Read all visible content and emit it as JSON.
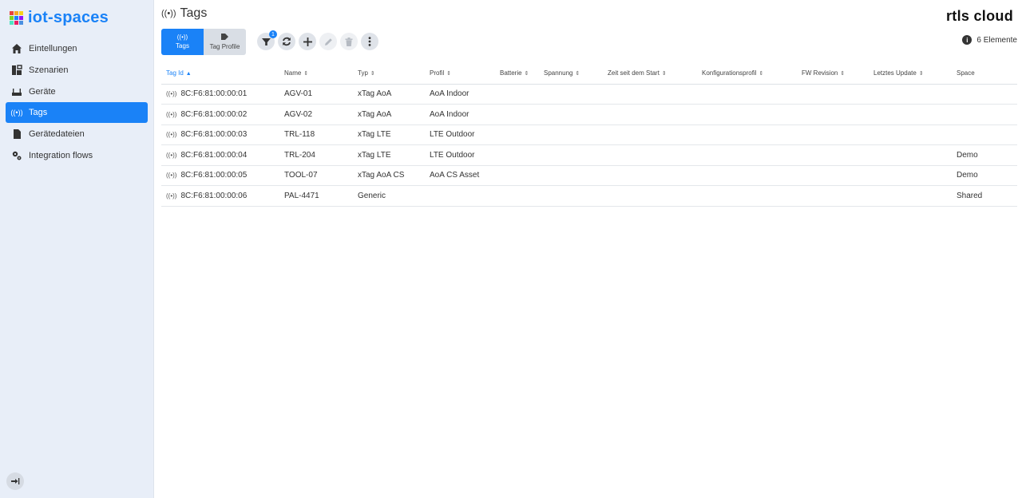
{
  "sidebar": {
    "brand": "iot-spaces",
    "brand_colors": [
      "#e8413c",
      "#f5a623",
      "#f8d11c",
      "#7ed321",
      "#1a82f7",
      "#9013fe",
      "#50e3c2",
      "#e91e63",
      "#4a90e2"
    ],
    "items": [
      {
        "label": "Eintellungen",
        "icon": "home-icon",
        "active": false
      },
      {
        "label": "Szenarien",
        "icon": "scenario-icon",
        "active": false
      },
      {
        "label": "Geräte",
        "icon": "device-icon",
        "active": false
      },
      {
        "label": "Tags",
        "icon": "broadcast-icon",
        "active": true
      },
      {
        "label": "Gerätedateien",
        "icon": "file-icon",
        "active": false
      },
      {
        "label": "Integration flows",
        "icon": "gears-icon",
        "active": false
      }
    ],
    "logout_icon": "logout-icon"
  },
  "header": {
    "title_icon": "((•))",
    "title": "Tags",
    "logo": "rtls cloud"
  },
  "toolbar": {
    "tabs": [
      {
        "label": "Tags",
        "icon": "((•))",
        "active": true
      },
      {
        "label": "Tag Profile",
        "icon": "tags-icon",
        "active": false
      }
    ],
    "filter_badge": "1",
    "element_count": "6 Elemente",
    "info_icon": "i"
  },
  "table": {
    "columns": [
      "Tag Id",
      "Name",
      "Typ",
      "Profil",
      "Batterie",
      "Spannung",
      "Zeit seit dem Start",
      "Konfigurationsprofil",
      "FW Revision",
      "Letztes Update",
      "Space"
    ],
    "sort_up": "▲",
    "sort_both": "⇕",
    "row_icon": "((•))",
    "rows": [
      {
        "tag_id": "8C:F6:81:00:00:01",
        "name": "AGV-01",
        "typ": "xTag AoA",
        "profil": "AoA Indoor",
        "space": ""
      },
      {
        "tag_id": "8C:F6:81:00:00:02",
        "name": "AGV-02",
        "typ": "xTag AoA",
        "profil": "AoA Indoor",
        "space": ""
      },
      {
        "tag_id": "8C:F6:81:00:00:03",
        "name": "TRL-118",
        "typ": "xTag LTE",
        "profil": "LTE Outdoor",
        "space": ""
      },
      {
        "tag_id": "8C:F6:81:00:00:04",
        "name": "TRL-204",
        "typ": "xTag LTE",
        "profil": "LTE Outdoor",
        "space": "Demo"
      },
      {
        "tag_id": "8C:F6:81:00:00:05",
        "name": "TOOL-07",
        "typ": "xTag AoA CS",
        "profil": "AoA CS Asset",
        "space": "Demo"
      },
      {
        "tag_id": "8C:F6:81:00:00:06",
        "name": "PAL-4471",
        "typ": "Generic",
        "profil": "",
        "space": "Shared"
      }
    ]
  }
}
